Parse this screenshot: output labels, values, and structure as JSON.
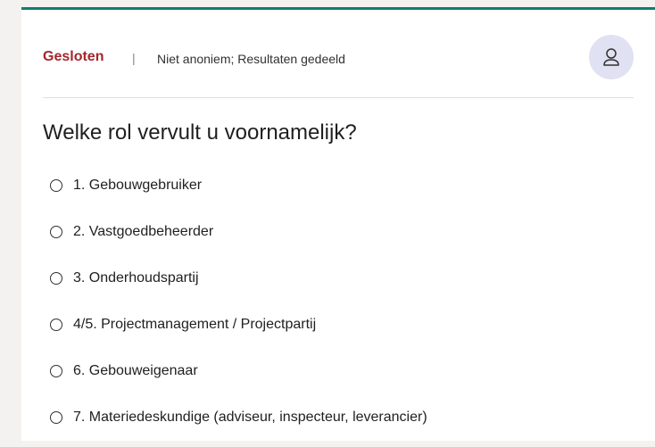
{
  "form": {
    "status": "Gesloten",
    "separator": "|",
    "meta": "Niet anoniem; Resultaten gedeeld",
    "avatar_icon": "person-icon",
    "accent_color": "#107c6e",
    "status_color": "#a4262c",
    "question": "Welke rol vervult u voornamelijk?",
    "options": [
      {
        "label": "1. Gebouwgebruiker"
      },
      {
        "label": "2. Vastgoedbeheerder"
      },
      {
        "label": "3. Onderhoudspartij"
      },
      {
        "label": "4/5. Projectmanagement / Projectpartij"
      },
      {
        "label": "6. Gebouweigenaar"
      },
      {
        "label": "7. Materiedeskundige (adviseur, inspecteur, leverancier)"
      }
    ]
  }
}
